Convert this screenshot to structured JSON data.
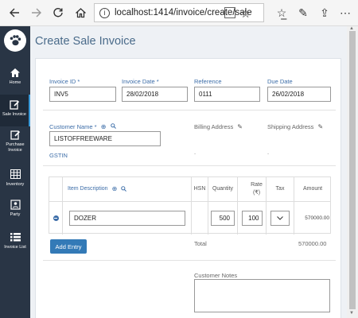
{
  "browser": {
    "url": "localhost:1414/invoice/create/sale",
    "back_icon": "arrow-left",
    "forward_icon": "arrow-right",
    "refresh_icon": "refresh",
    "home_icon": "home",
    "info_icon": "i"
  },
  "sidebar": {
    "items": [
      {
        "label": "Home",
        "icon": "home-icon"
      },
      {
        "label": "Sale Invoice",
        "icon": "edit-icon"
      },
      {
        "label": "Purchase Invoice",
        "icon": "edit-icon"
      },
      {
        "label": "Inventory",
        "icon": "table-icon"
      },
      {
        "label": "Party",
        "icon": "party-icon"
      },
      {
        "label": "Invoice List",
        "icon": "list-icon"
      }
    ]
  },
  "page": {
    "title": "Create Sale Invoice"
  },
  "form": {
    "invoice_id_label": "Invoice ID *",
    "invoice_id_value": "INV5",
    "invoice_date_label": "Invoice Date *",
    "invoice_date_value": "28/02/2018",
    "reference_label": "Reference",
    "reference_value": "0111",
    "due_date_label": "Due Date",
    "due_date_value": "26/02/2018",
    "customer_name_label": "Customer Name *",
    "customer_name_value": "LISTOFFREEWARE",
    "gstin_label": "GSTIN",
    "billing_address_label": "Billing Address",
    "billing_address_value": ".",
    "shipping_address_label": "Shipping Address",
    "shipping_address_value": "."
  },
  "table": {
    "headers": {
      "item_description": "Item Description",
      "hsn": "HSN",
      "quantity": "Quantity",
      "rate_line1": "Rate",
      "rate_line2": "(₹)",
      "tax": "Tax",
      "amount": "Amount"
    },
    "rows": [
      {
        "item": "DOZER",
        "hsn": "",
        "quantity": "500",
        "rate": "100",
        "tax": "",
        "amount": "570000.00"
      }
    ]
  },
  "actions": {
    "add_entry_label": "Add Entry"
  },
  "totals": {
    "total_label": "Total",
    "total_value": "570000.00"
  },
  "notes": {
    "customer_notes_label": "Customer Notes"
  }
}
